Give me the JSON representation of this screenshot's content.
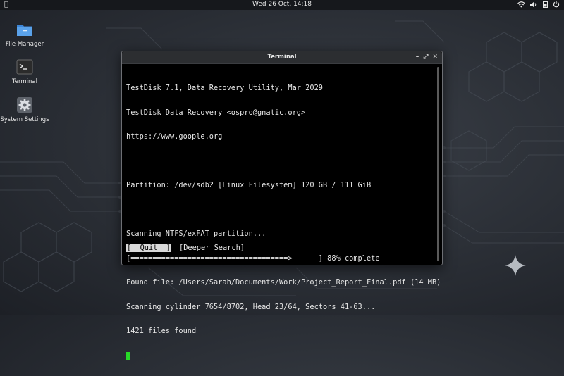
{
  "topbar": {
    "clock": "Wed 26 Oct, 14:18",
    "icons": [
      "apple-logo-icon",
      "wifi-icon",
      "volume-icon",
      "battery-icon",
      "power-icon"
    ]
  },
  "desktop": {
    "icons": [
      {
        "label": "File Manager",
        "icon": "folder-icon"
      },
      {
        "label": "Terminal",
        "icon": "terminal-icon"
      },
      {
        "label": "System Settings",
        "icon": "gear-icon"
      }
    ]
  },
  "window": {
    "title": "Terminal",
    "controls": [
      "minimize",
      "maximize",
      "close"
    ]
  },
  "terminal": {
    "lines": [
      "TestDisk 7.1, Data Recovery Utility, Mar 2029",
      "TestDisk Data Recovery <ospro@gnatic.org>",
      "https://www.goople.org",
      "",
      "Partition: /dev/sdb2 [Linux Filesystem] 120 GB / 111 GiB",
      "",
      "Scanning NTFS/exFAT partition...",
      "[====================================>      ] 88% complete",
      "Found file: /Users/Sarah/Documents/Work/Project_Report_Final.pdf (14 MB)",
      "Scanning cylinder 7654/8702, Head 23/64, Sectors 41-63...",
      "1421 files found"
    ],
    "buttons": [
      {
        "label": "[  Quit  ]",
        "selected": true
      },
      {
        "label": "[Deeper Search]",
        "selected": false
      }
    ]
  },
  "colors": {
    "cursor": "#27d827",
    "terminal_bg": "#000000",
    "titlebar": "#2c2e31"
  }
}
